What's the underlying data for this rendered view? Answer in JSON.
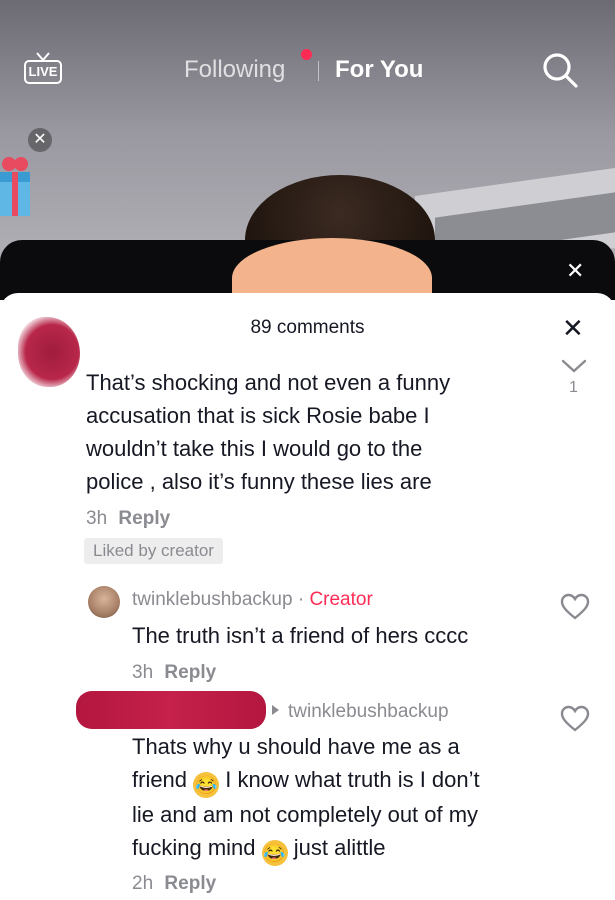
{
  "nav": {
    "live_label": "LIVE",
    "following_label": "Following",
    "foryou_label": "For You"
  },
  "comments_panel": {
    "title": "89 comments",
    "nav_count": "1",
    "comments": [
      {
        "text_lines": [
          "That’s shocking and not even a funny",
          "accusation that is sick Rosie babe I",
          "wouldn’t take this I would go to the",
          "police , also it’s funny these lies are"
        ],
        "time": "3h",
        "reply_label": "Reply",
        "liked_badge": "Liked by creator"
      },
      {
        "username": "twinklebushbackup",
        "separator": " · ",
        "creator_tag": "Creator",
        "text": "The truth isn’t a friend of hers cccc",
        "time": "3h",
        "reply_label": "Reply"
      },
      {
        "reply_to": "twinklebushbackup",
        "line1": "Thats why u should have me as a",
        "line2_a": "friend",
        "line2_b": "I know what truth is I don’t",
        "line3": "lie and am not completely out of my",
        "line4_a": "fucking mind",
        "line4_b": "just alittle",
        "time": "2h",
        "reply_label": "Reply"
      }
    ]
  },
  "colors": {
    "creator": "#fe2c55",
    "meta": "#8a8b91",
    "text": "#161823"
  },
  "icons": [
    "live-icon",
    "search-icon",
    "close-icon",
    "gift-icon",
    "chevron-down-icon",
    "heart-outline-icon",
    "laughing-emoji-icon"
  ]
}
